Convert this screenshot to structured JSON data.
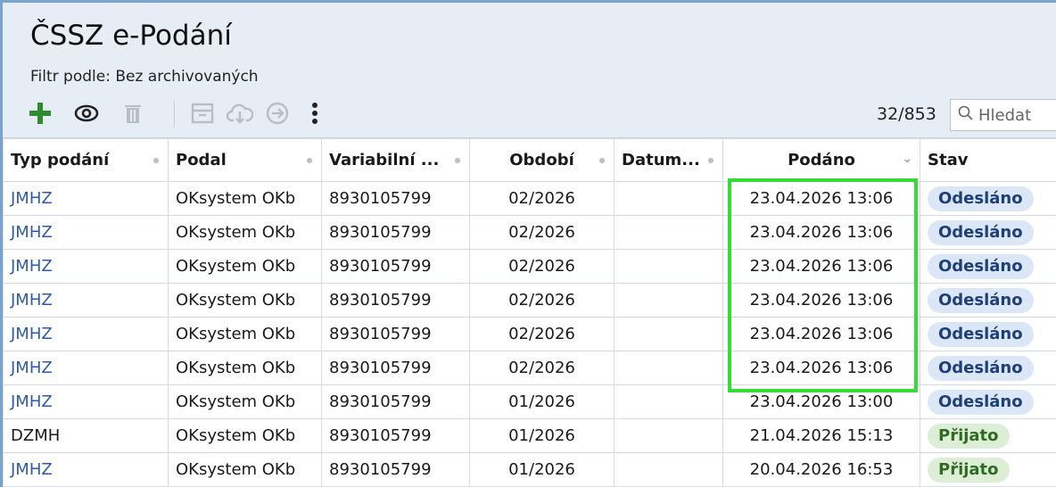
{
  "header": {
    "title": "ČSSZ e-Podání",
    "filter": "Filtr podle: Bez archivovaných"
  },
  "toolbar": {
    "icons": [
      "add-icon",
      "eye-icon",
      "trash-icon",
      "archive-icon",
      "cloud-download-icon",
      "arrow-right-circle-icon",
      "more-vertical-icon"
    ],
    "accent_add": "#2e8b2e",
    "counter": "32/853",
    "search_placeholder": "Hledat"
  },
  "table": {
    "columns": [
      "Typ podání",
      "Podal",
      "Variabilní ...",
      "Období",
      "Datum...",
      "Podáno",
      "Stav"
    ],
    "rows": [
      {
        "typ": "JMHZ",
        "podal": "OKsystem OKb",
        "var": "8930105799",
        "obdobi": "02/2026",
        "datum": "",
        "podano": "23.04.2026 13:06",
        "stav": "Odesláno"
      },
      {
        "typ": "JMHZ",
        "podal": "OKsystem OKb",
        "var": "8930105799",
        "obdobi": "02/2026",
        "datum": "",
        "podano": "23.04.2026 13:06",
        "stav": "Odesláno"
      },
      {
        "typ": "JMHZ",
        "podal": "OKsystem OKb",
        "var": "8930105799",
        "obdobi": "02/2026",
        "datum": "",
        "podano": "23.04.2026 13:06",
        "stav": "Odesláno"
      },
      {
        "typ": "JMHZ",
        "podal": "OKsystem OKb",
        "var": "8930105799",
        "obdobi": "02/2026",
        "datum": "",
        "podano": "23.04.2026 13:06",
        "stav": "Odesláno"
      },
      {
        "typ": "JMHZ",
        "podal": "OKsystem OKb",
        "var": "8930105799",
        "obdobi": "02/2026",
        "datum": "",
        "podano": "23.04.2026 13:06",
        "stav": "Odesláno"
      },
      {
        "typ": "JMHZ",
        "podal": "OKsystem OKb",
        "var": "8930105799",
        "obdobi": "02/2026",
        "datum": "",
        "podano": "23.04.2026 13:06",
        "stav": "Odesláno"
      },
      {
        "typ": "JMHZ",
        "podal": "OKsystem OKb",
        "var": "8930105799",
        "obdobi": "01/2026",
        "datum": "",
        "podano": "23.04.2026 13:00",
        "stav": "Odesláno"
      },
      {
        "typ": "DZMH",
        "podal": "OKsystem OKb",
        "var": "8930105799",
        "obdobi": "01/2026",
        "datum": "",
        "podano": "21.04.2026 15:13",
        "stav": "Přijato"
      },
      {
        "typ": "JMHZ",
        "podal": "OKsystem OKb",
        "var": "8930105799",
        "obdobi": "01/2026",
        "datum": "",
        "podano": "20.04.2026 16:53",
        "stav": "Přijato"
      }
    ],
    "status_colors": {
      "Odesláno": {
        "bg": "#dbe7f7",
        "fg": "#1f3f78"
      },
      "Přijato": {
        "bg": "#dcefd6",
        "fg": "#2f6b22"
      }
    },
    "link_color": "#2e5aa8"
  }
}
